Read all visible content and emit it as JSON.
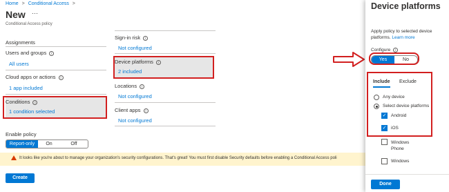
{
  "breadcrumb": {
    "home": "Home",
    "sep": ">",
    "current": "Conditional Access",
    "sep2": ">"
  },
  "header": {
    "title": "New",
    "more": "···",
    "subtitle": "Conditional Access policy"
  },
  "assignments": {
    "heading": "Assignments",
    "users_label": "Users and groups",
    "users_value": "All users",
    "cloud_label": "Cloud apps or actions",
    "cloud_value": "1 app included",
    "conditions_label": "Conditions",
    "conditions_value": "1 condition selected"
  },
  "conditions": {
    "signin_label": "Sign-in risk",
    "signin_value": "Not configured",
    "device_label": "Device platforms",
    "device_value": "2 included",
    "locations_label": "Locations",
    "locations_value": "Not configured",
    "client_label": "Client apps",
    "client_value": "Not configured"
  },
  "enable_policy": {
    "label": "Enable policy",
    "options": [
      "Report-only",
      "On",
      "Off"
    ],
    "selected": "Report-only"
  },
  "warning": {
    "text": "It looks like you're about to manage your organization's security configurations. That's great! You must first disable Security defaults before enabling a Conditional Access poli"
  },
  "create_button": "Create",
  "panel": {
    "title": "Device platforms",
    "description": "Apply policy to selected device platforms.",
    "learn_more": "Learn more",
    "configure_label": "Configure",
    "configure_options": [
      "Yes",
      "No"
    ],
    "configure_selected": "Yes",
    "tabs": [
      "Include",
      "Exclude"
    ],
    "active_tab": "Include",
    "radio_any": "Any device",
    "radio_select": "Select device platforms",
    "platforms": [
      {
        "label": "Android",
        "checked": true
      },
      {
        "label": "iOS",
        "checked": true
      },
      {
        "label": "Windows Phone",
        "checked": false
      },
      {
        "label": "Windows",
        "checked": false
      }
    ],
    "done_button": "Done"
  },
  "colors": {
    "accent": "#0078d4",
    "highlight": "#d21f1f",
    "warning_bg": "#fff4ce"
  }
}
